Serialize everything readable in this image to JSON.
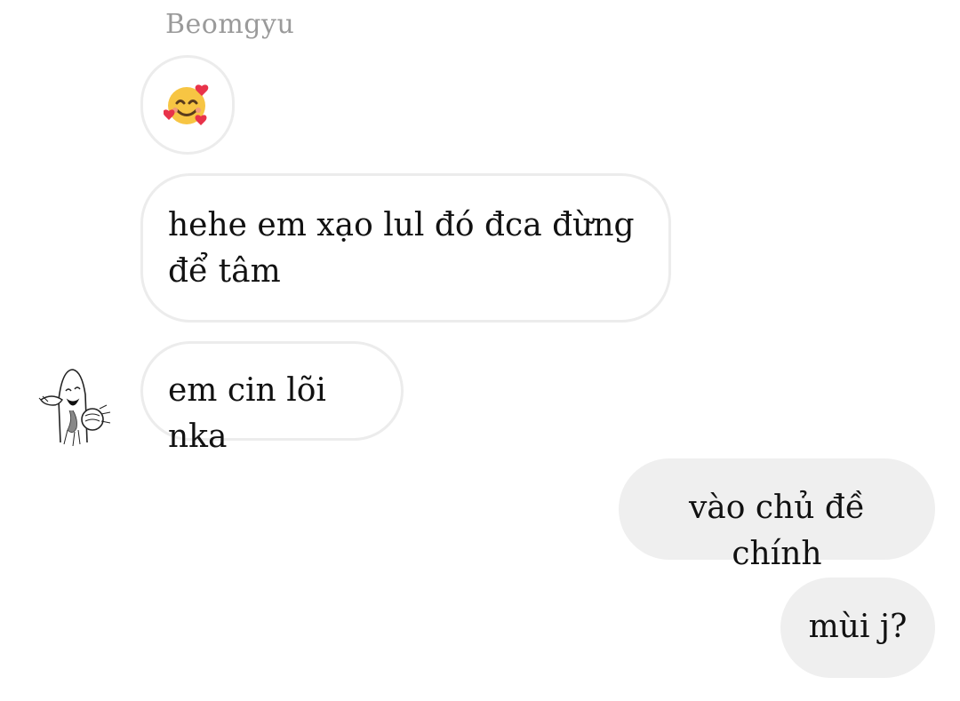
{
  "conversation": {
    "sender_name": "Beomgyu",
    "incoming": [
      {
        "type": "emoji",
        "emoji_name": "smiling-face-with-hearts"
      },
      {
        "type": "text",
        "text": "hehe em xạo lul đó đca đừng để tâm"
      },
      {
        "type": "text",
        "text": "em cin lõi nka"
      }
    ],
    "outgoing": [
      {
        "type": "text",
        "text": "vào chủ đề chính"
      },
      {
        "type": "text",
        "text": "mùi j?"
      }
    ],
    "avatar": {
      "icon": "sketch-character-avatar"
    }
  },
  "colors": {
    "incoming_bubble_bg": "#ffffff",
    "incoming_bubble_border": "#ececec",
    "outgoing_bubble_bg": "#efefef",
    "sender_name": "#9a9a9a",
    "message_text": "#111111"
  }
}
